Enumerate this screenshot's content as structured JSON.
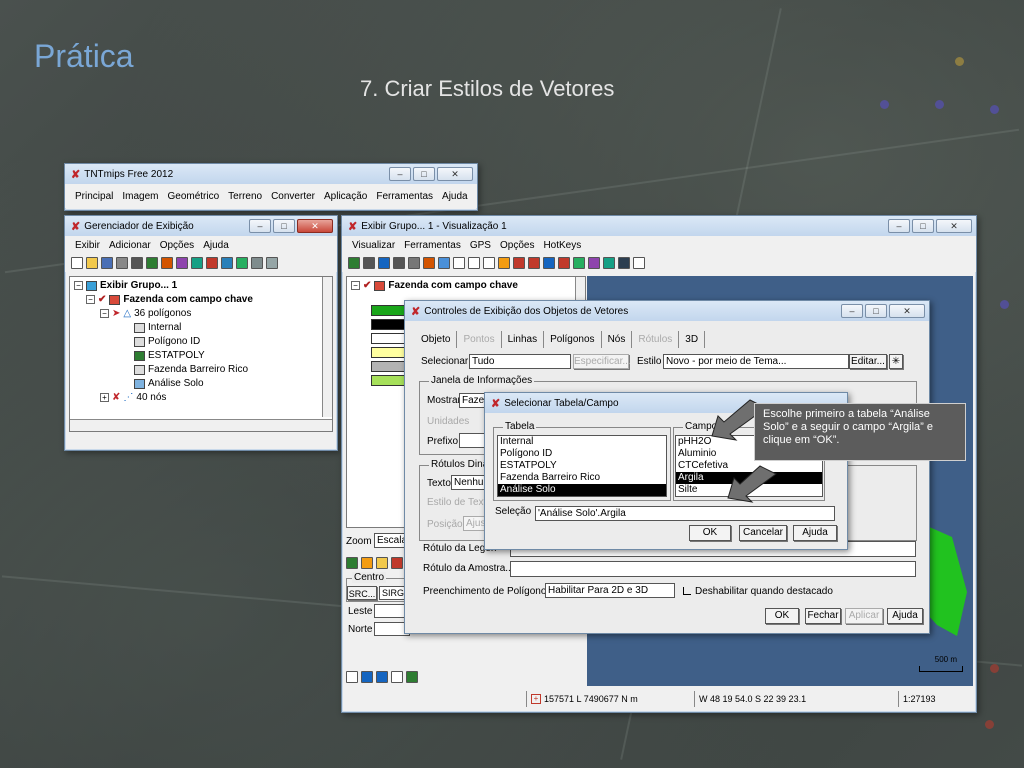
{
  "slide": {
    "title": "Prática",
    "subtitle": "7. Criar Estilos de Vetores"
  },
  "tntmips": {
    "title": "TNTmips Free 2012",
    "menu": [
      "Principal",
      "Imagem",
      "Geométrico",
      "Terreno",
      "Converter",
      "Aplicação",
      "Ferramentas",
      "Ajuda"
    ]
  },
  "gerenciador": {
    "title": "Gerenciador de Exibição",
    "menu": [
      "Exibir",
      "Adicionar",
      "Opções",
      "Ajuda"
    ],
    "tree": {
      "group": "Exibir Grupo... 1",
      "layer": "Fazenda com campo chave",
      "polygons": "36 polígonos",
      "tables": [
        "Internal",
        "Polígono ID",
        "ESTATPOLY",
        "Fazenda Barreiro Rico",
        "Análise Solo"
      ],
      "nodes": "40 nós"
    }
  },
  "visualizacao": {
    "title": "Exibir Grupo... 1 - Visualização 1",
    "menu": [
      "Visualizar",
      "Ferramentas",
      "GPS",
      "Opções",
      "HotKeys"
    ],
    "tree_layer": "Fazenda com campo chave",
    "legend_colors": [
      "#1aa61a",
      "#000000",
      "#ffffff",
      "#ffffa0",
      "#b3b3b3",
      "#a6e05a"
    ],
    "side_labels": {
      "zoom": "Zoom",
      "escala": "Escala",
      "centro": "Centro",
      "src": "SRC...",
      "sirg": "SIRG",
      "leste": "Leste",
      "norte": "Norte"
    },
    "scale_text": "500 m",
    "status": {
      "coords": "157571 L 7490677 N m",
      "geo": "W 48 19 54.0  S 22 39 23.1",
      "scale": "1:27193"
    }
  },
  "controles": {
    "title": "Controles de Exibição dos Objetos de Vetores",
    "tabs": [
      {
        "label": "Objeto",
        "enabled": true
      },
      {
        "label": "Pontos",
        "enabled": false
      },
      {
        "label": "Linhas",
        "enabled": true
      },
      {
        "label": "Polígonos",
        "enabled": true
      },
      {
        "label": "Nós",
        "enabled": true
      },
      {
        "label": "Rótulos",
        "enabled": false
      },
      {
        "label": "3D",
        "enabled": true
      }
    ],
    "selecionar_label": "Selecionar",
    "selecionar_value": "Tudo",
    "especificar_label": "Especificar...",
    "estilo_label": "Estilo",
    "estilo_value": "Novo - por meio de Tema...",
    "editar_label": "Editar...",
    "janela_info": "Janela de Informações",
    "mostrar_label": "Mostrar",
    "mostrar_value": "Fazen",
    "unidades_label": "Unidades",
    "prefixo_label": "Prefixo",
    "rotulos_din": "Rótulos Dinâ",
    "texto_label": "Texto",
    "texto_value": "Nenhum",
    "estilo_texto": "Estilo de Text",
    "posicao_label": "Posição",
    "posicao_value": "Ajus",
    "rotulo_legenda": "Rótulo da Legen",
    "rotulo_amostra": "Rótulo da Amostra...",
    "preenchimento_label": "Preenchimento de Polígonos",
    "preenchimento_value": "Habilitar Para 2D e 3D",
    "desabilitar_label": "Deshabilitar quando destacado",
    "buttons": {
      "ok": "OK",
      "fechar": "Fechar",
      "aplicar": "Aplicar",
      "ajuda": "Ajuda"
    }
  },
  "selecionar_tabela": {
    "title": "Selecionar Tabela/Campo",
    "tabela_label": "Tabela",
    "tabelas": [
      "Internal",
      "Polígono ID",
      "ESTATPOLY",
      "Fazenda Barreiro Rico",
      "Análise Solo"
    ],
    "tabela_selected": "Análise Solo",
    "campo_label": "Campo",
    "campos": [
      "pHH2O",
      "Aluminio",
      "CTCefetiva",
      "Argila",
      "Silte"
    ],
    "campo_selected": "Argila",
    "selecao_label": "Seleção",
    "selecao_value": "'Análise Solo'.Argila",
    "buttons": {
      "ok": "OK",
      "cancelar": "Cancelar",
      "ajuda": "Ajuda"
    }
  },
  "callout": {
    "text": "Escolhe primeiro a tabela “Análise Solo” e a seguir o campo “Argila” e clique em “OK”."
  }
}
